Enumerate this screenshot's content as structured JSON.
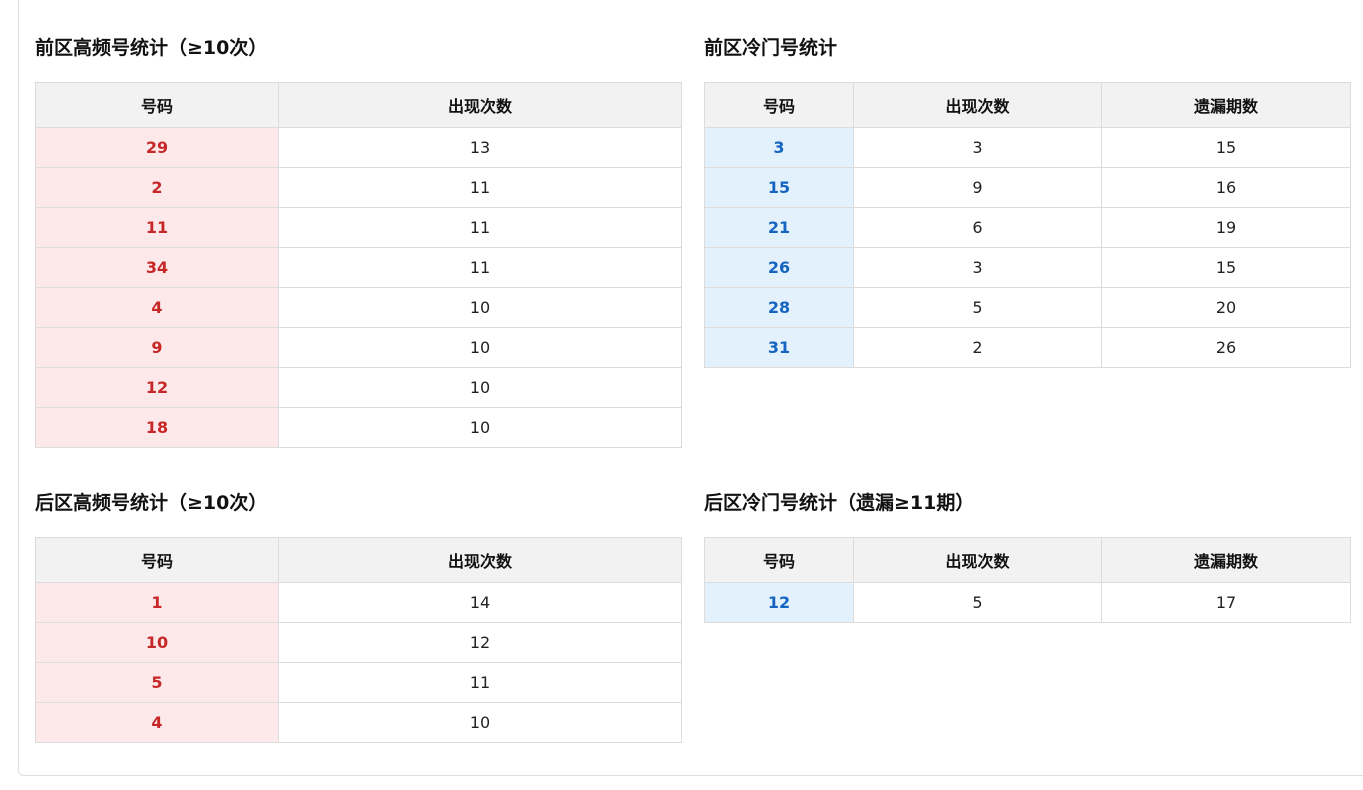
{
  "sections": {
    "front_hot": {
      "title": "前区高频号统计（≥10次）",
      "headers": [
        "号码",
        "出现次数"
      ],
      "rows": [
        [
          "29",
          "13"
        ],
        [
          "2",
          "11"
        ],
        [
          "11",
          "11"
        ],
        [
          "34",
          "11"
        ],
        [
          "4",
          "10"
        ],
        [
          "9",
          "10"
        ],
        [
          "12",
          "10"
        ],
        [
          "18",
          "10"
        ]
      ]
    },
    "front_cold": {
      "title": "前区冷门号统计",
      "headers": [
        "号码",
        "出现次数",
        "遗漏期数"
      ],
      "rows": [
        [
          "3",
          "3",
          "15"
        ],
        [
          "15",
          "9",
          "16"
        ],
        [
          "21",
          "6",
          "19"
        ],
        [
          "26",
          "3",
          "15"
        ],
        [
          "28",
          "5",
          "20"
        ],
        [
          "31",
          "2",
          "26"
        ]
      ]
    },
    "back_hot": {
      "title": "后区高频号统计（≥10次）",
      "headers": [
        "号码",
        "出现次数"
      ],
      "rows": [
        [
          "1",
          "14"
        ],
        [
          "10",
          "12"
        ],
        [
          "5",
          "11"
        ],
        [
          "4",
          "10"
        ]
      ]
    },
    "back_cold": {
      "title": "后区冷门号统计（遗漏≥11期）",
      "headers": [
        "号码",
        "出现次数",
        "遗漏期数"
      ],
      "rows": [
        [
          "12",
          "5",
          "17"
        ]
      ]
    }
  },
  "colors": {
    "hot_bg": "#fde8ea",
    "hot_text": "#c62828",
    "cold_bg": "#e3f1fc",
    "cold_text": "#1565c0",
    "header_bg": "#f2f2f2"
  }
}
